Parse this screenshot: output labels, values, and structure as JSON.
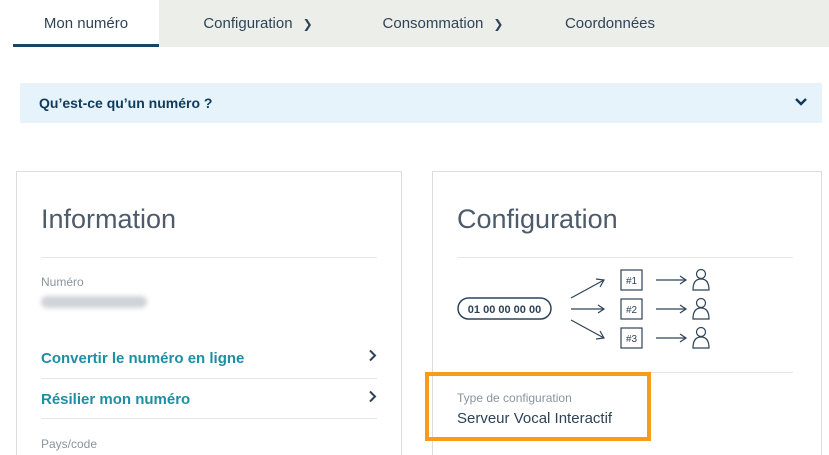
{
  "tabs": [
    {
      "label": "Mon numéro"
    },
    {
      "label": "Configuration",
      "chevron": "chevron-down-icon"
    },
    {
      "label": "Consommation",
      "chevron": "chevron-down-icon"
    },
    {
      "label": "Coordonnées"
    }
  ],
  "faq": {
    "question": "Qu’est-ce qu’un numéro ?"
  },
  "info": {
    "title": "Information",
    "number_label": "Numéro",
    "convert_link": "Convertir le numéro en ligne",
    "cancel_link": "Résilier mon numéro",
    "country_label": "Pays/code"
  },
  "config": {
    "title": "Configuration",
    "diagram": {
      "number": "01 00 00 00 00",
      "keys": [
        "#1",
        "#2",
        "#3"
      ]
    },
    "type_label": "Type de configuration",
    "type_value": "Serveur Vocal Interactif"
  },
  "colors": {
    "accent_link": "#1d8fa3",
    "highlight_border": "#f89b1a",
    "faq_bg": "#e6f3fb",
    "tab_bar": "#eceeea"
  }
}
